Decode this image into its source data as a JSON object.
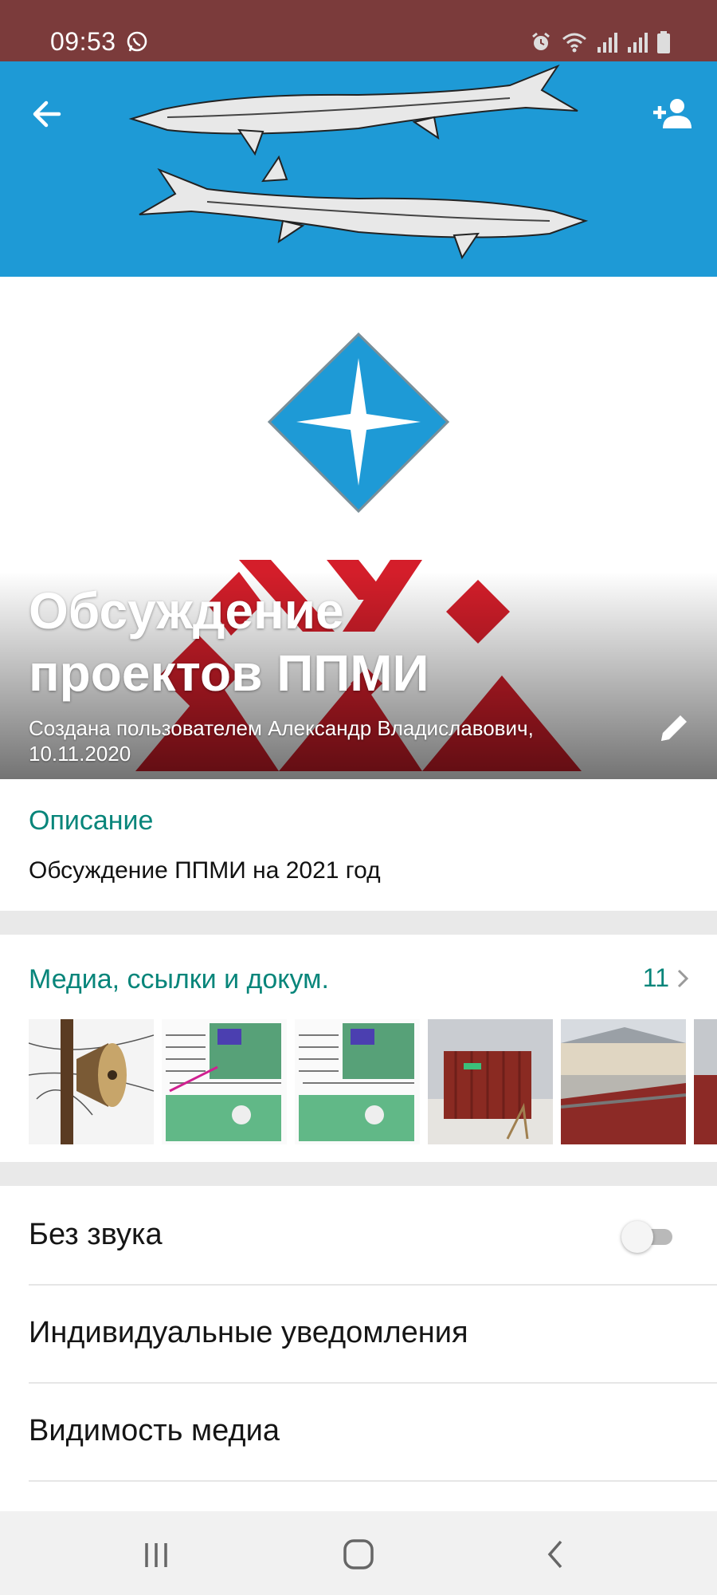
{
  "status_bar": {
    "time": "09:53",
    "icons": [
      "whatsapp-icon",
      "alarm-icon",
      "wifi-icon",
      "signal-icon",
      "signal-icon",
      "battery-icon"
    ]
  },
  "header": {
    "title": "Обсуждение проектов ППМИ",
    "subtitle": "Создана пользователем Александр Владиславович, 10.11.2020",
    "icons": {
      "back": "arrow-left-icon",
      "add_member": "person-add-icon",
      "edit": "pencil-icon"
    },
    "colors": {
      "sky_blue": "#1e9ad6",
      "red": "#d41e2a"
    }
  },
  "description": {
    "heading": "Описание",
    "text": "Обсуждение ППМИ на 2021 год"
  },
  "media": {
    "heading": "Медиа, ссылки и докум.",
    "count": "11",
    "thumbnails": [
      "loudspeaker-photo",
      "site-plan-document",
      "site-plan-document",
      "red-container-photo",
      "fence-building-photo",
      "partial-photo"
    ]
  },
  "settings": {
    "mute_label": "Без звука",
    "mute_enabled": false,
    "custom_notifications_label": "Индивидуальные уведомления",
    "media_visibility_label": "Видимость медиа"
  },
  "colors": {
    "status_bar": "#7b3b3b",
    "accent": "#07857a"
  },
  "nav": [
    "recents-icon",
    "home-icon",
    "back-icon"
  ]
}
